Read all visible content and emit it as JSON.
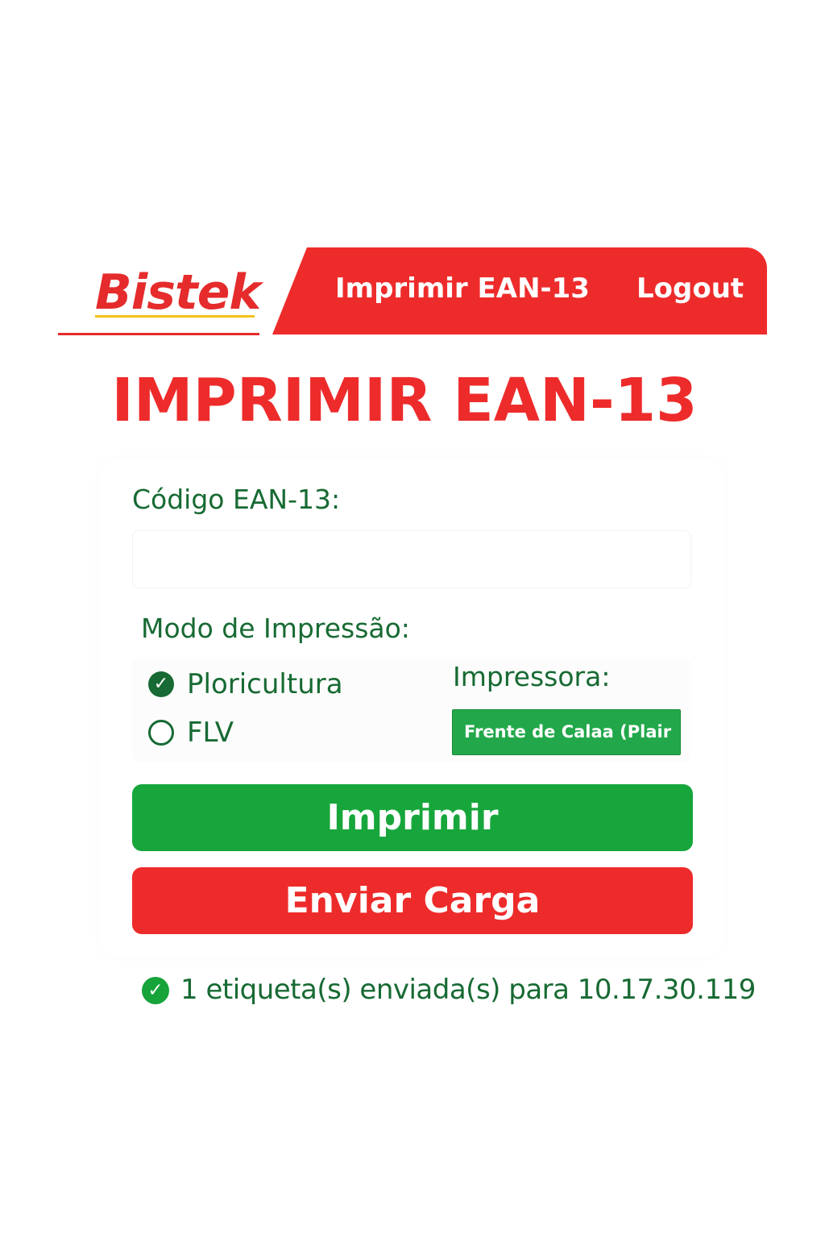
{
  "header": {
    "logo_text": "Bistek",
    "nav": {
      "print_link": "Imprimir EAN-13",
      "logout_link": "Logout"
    }
  },
  "page": {
    "title": "IMPRIMIR EAN-13"
  },
  "form": {
    "ean_label": "Código EAN-13:",
    "ean_value": "",
    "print_mode_label": "Modo de Impressão:",
    "print_mode_options": [
      {
        "label": "Ploricultura",
        "selected": true
      },
      {
        "label": "FLV",
        "selected": false
      }
    ],
    "printer_label": "Impressora:",
    "printer_selected": "Frente de Calaa (Plair"
  },
  "actions": {
    "print_button": "Imprimir",
    "load_button": "Enviar Carga"
  },
  "status": {
    "icon": "check-circle-icon",
    "message": "1 etiqueta(s) enviada(s) para 10.17.30.119"
  },
  "colors": {
    "brand_red": "#ee2b2b",
    "brand_green": "#17a63b",
    "text_green": "#176a33",
    "logo_underline": "#f2c21b"
  }
}
